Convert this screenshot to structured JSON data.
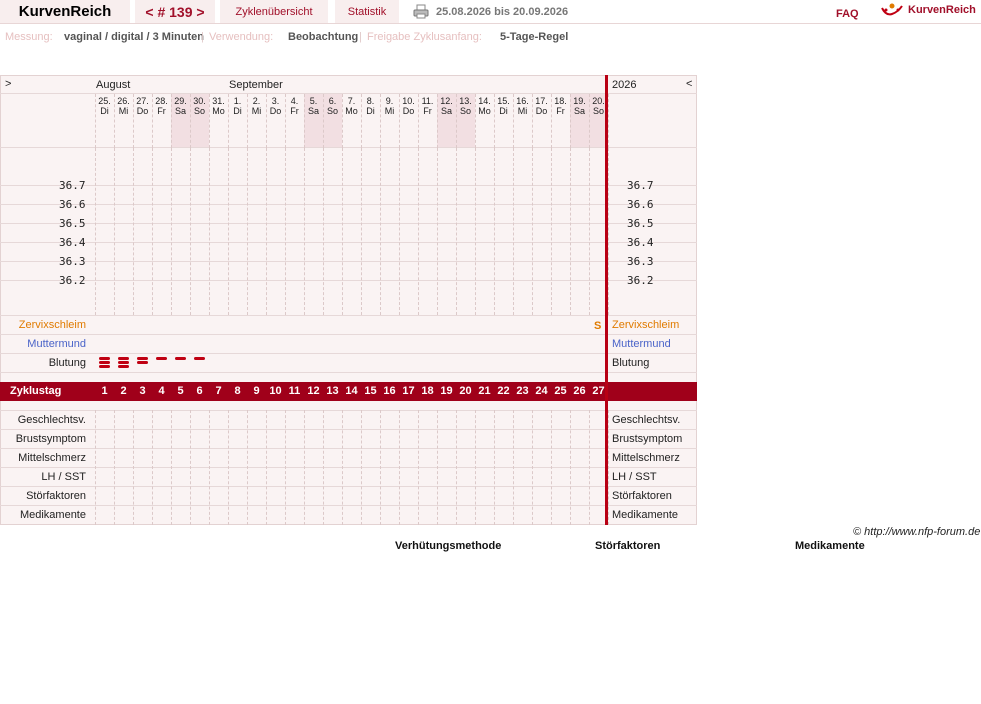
{
  "header": {
    "brand": "KurvenReich",
    "cycle_label": "< # 139 >",
    "tab_overview": "Zyklenübersicht",
    "tab_stats": "Statistik",
    "date_range": "25.08.2026 bis 20.09.2026",
    "faq": "FAQ",
    "logo_text": "KurvenReich"
  },
  "info": {
    "measure_label": "Messung:",
    "measure_value": "vaginal / digital / 3 Minuten",
    "use_label": "Verwendung:",
    "use_value": "Beobachtung",
    "release_label": "Freigabe Zyklusanfang:",
    "release_value": "5-Tage-Regel"
  },
  "chart": {
    "nav_left": ">",
    "nav_right": "<",
    "month1": "August",
    "month2": "September",
    "year": "2026",
    "days": [
      {
        "d": "25.",
        "w": "Di"
      },
      {
        "d": "26.",
        "w": "Mi"
      },
      {
        "d": "27.",
        "w": "Do"
      },
      {
        "d": "28.",
        "w": "Fr"
      },
      {
        "d": "29.",
        "w": "Sa"
      },
      {
        "d": "30.",
        "w": "So"
      },
      {
        "d": "31.",
        "w": "Mo"
      },
      {
        "d": "1.",
        "w": "Di"
      },
      {
        "d": "2.",
        "w": "Mi"
      },
      {
        "d": "3.",
        "w": "Do"
      },
      {
        "d": "4.",
        "w": "Fr"
      },
      {
        "d": "5.",
        "w": "Sa"
      },
      {
        "d": "6.",
        "w": "So"
      },
      {
        "d": "7.",
        "w": "Mo"
      },
      {
        "d": "8.",
        "w": "Di"
      },
      {
        "d": "9.",
        "w": "Mi"
      },
      {
        "d": "10.",
        "w": "Do"
      },
      {
        "d": "11.",
        "w": "Fr"
      },
      {
        "d": "12.",
        "w": "Sa"
      },
      {
        "d": "13.",
        "w": "So"
      },
      {
        "d": "14.",
        "w": "Mo"
      },
      {
        "d": "15.",
        "w": "Di"
      },
      {
        "d": "16.",
        "w": "Mi"
      },
      {
        "d": "17.",
        "w": "Do"
      },
      {
        "d": "18.",
        "w": "Fr"
      },
      {
        "d": "19.",
        "w": "Sa"
      },
      {
        "d": "20.",
        "w": "So"
      }
    ],
    "temps": [
      "36.7",
      "36.6",
      "36.5",
      "36.4",
      "36.3",
      "36.2"
    ],
    "row_cervix": "Zervixschleim",
    "row_cervix_mark": "S",
    "row_mumu": "Muttermund",
    "row_bleed": "Blutung",
    "row_cycleday": "Zyklustag",
    "bleeding_strength": [
      3,
      3,
      2,
      1,
      1,
      1
    ],
    "bottom_rows": [
      "Geschlechtsv.",
      "Brustsymptom",
      "Mittelschmerz",
      "LH / SST",
      "Störfaktoren",
      "Medikamente"
    ],
    "colors": {
      "accent": "#a0001a",
      "cervix": "#e07b00",
      "mumu": "#4a63c8"
    }
  },
  "footer": {
    "copyright": "© http://www.nfp-forum.de",
    "col1": "Verhütungsmethode",
    "col2": "Störfaktoren",
    "col3": "Medikamente"
  }
}
